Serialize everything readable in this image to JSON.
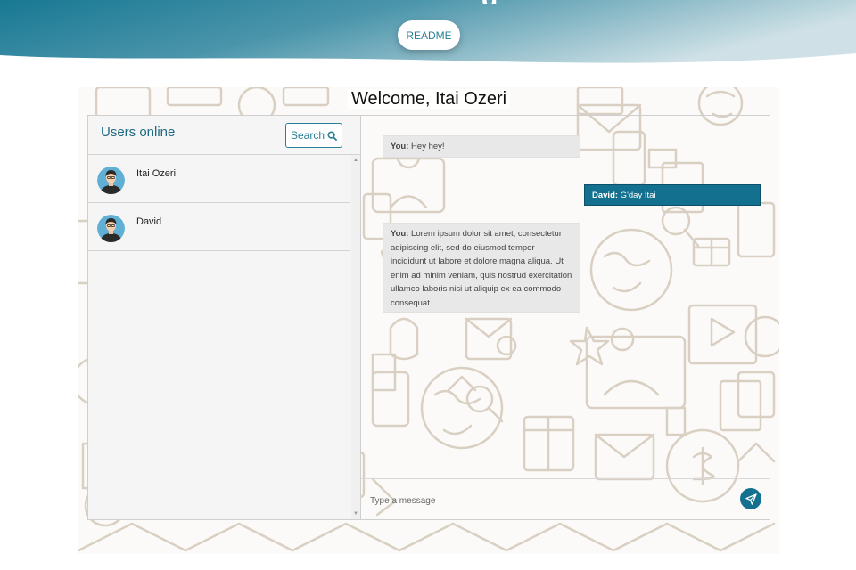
{
  "header": {
    "title_fragment": "g",
    "readme_label": "README"
  },
  "welcome": "Welcome, Itai Ozeri",
  "users_panel": {
    "title": "Users online",
    "search_label": "Search",
    "users": [
      {
        "name": "Itai Ozeri"
      },
      {
        "name": "David"
      }
    ]
  },
  "messages": [
    {
      "sender": "You:",
      "text": " Hey hey!",
      "side": "left"
    },
    {
      "sender": "David:",
      "text": " G'day Itai",
      "side": "right"
    },
    {
      "sender": "You:",
      "text": " Lorem ipsum dolor sit amet, consectetur adipiscing elit, sed do eiusmod tempor incididunt ut labore et dolore magna aliqua. Ut enim ad minim veniam, quis nostrud exercitation ullamco laboris nisi ut aliquip ex ea commodo consequat.",
      "side": "left"
    }
  ],
  "composer": {
    "placeholder": "Type a message"
  },
  "colors": {
    "accent": "#13708e",
    "banner_start": "#1a7a96",
    "banner_end": "#c8dde4",
    "bubble_you": "#e8e8e8"
  }
}
